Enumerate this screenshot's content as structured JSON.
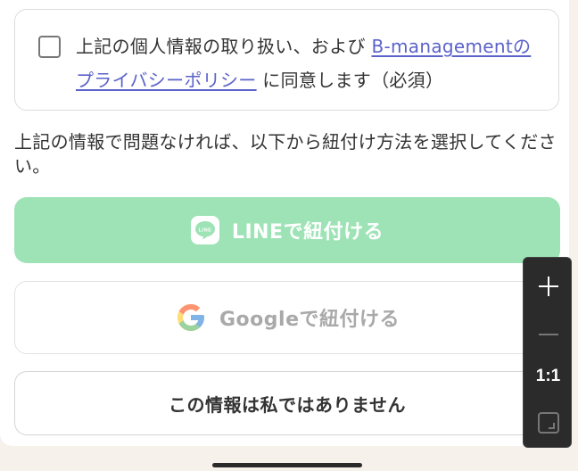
{
  "consent": {
    "prefix": "上記の個人情報の取り扱い、および",
    "link": "B-managementのプライバシーポリシー",
    "suffix": "に同意します（必須）",
    "checked": false
  },
  "instruction": "上記の情報で問題なければ、以下から紐付け方法を選択してください。",
  "buttons": {
    "line": "LINEで紐付ける",
    "line_icon_text": "LINE",
    "google": "Googleで紐付ける",
    "not_me": "この情報は私ではありません"
  },
  "zoom": {
    "ratio": "1:1",
    "icons": [
      "plus-icon",
      "minus-icon",
      "fit-screen-icon"
    ]
  },
  "colors": {
    "line_button": "#9ee3b6",
    "link": "#5b62c9"
  }
}
